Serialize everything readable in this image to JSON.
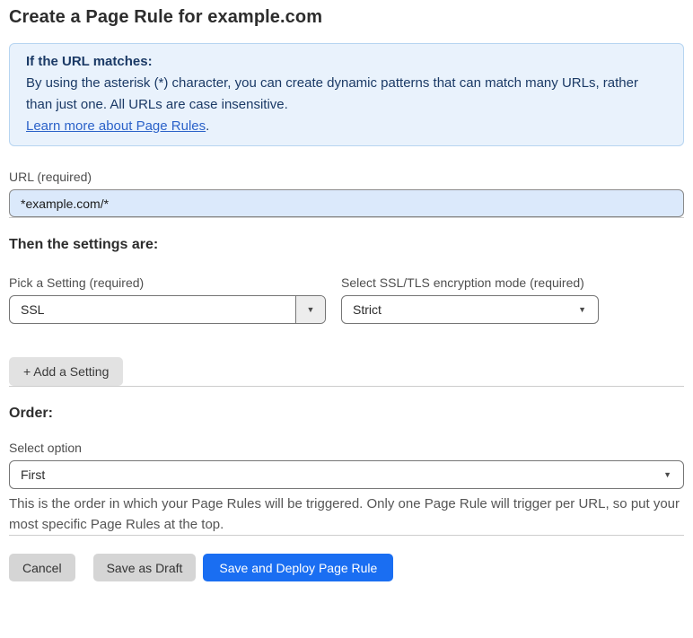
{
  "page": {
    "title": "Create a Page Rule for example.com"
  },
  "info_box": {
    "heading": "If the URL matches:",
    "body": "By using the asterisk (*) character, you can create dynamic patterns that can match many URLs, rather than just one. All URLs are case insensitive.",
    "link_label": "Learn more about Page Rules",
    "link_suffix": "."
  },
  "url_field": {
    "label": "URL (required)",
    "value": "*example.com/*"
  },
  "settings_section": {
    "heading": "Then the settings are:",
    "setting_picker": {
      "label": "Pick a Setting (required)",
      "value": "SSL"
    },
    "ssl_mode": {
      "label": "Select SSL/TLS encryption mode (required)",
      "value": "Strict"
    },
    "add_setting_label": "+ Add a Setting"
  },
  "order_section": {
    "heading": "Order:",
    "select_label": "Select option",
    "value": "First",
    "help_text": "This is the order in which your Page Rules will be triggered. Only one Page Rule will trigger per URL, so put your most specific Page Rules at the top."
  },
  "footer": {
    "cancel_label": "Cancel",
    "save_draft_label": "Save as Draft",
    "save_deploy_label": "Save and Deploy Page Rule"
  },
  "icons": {
    "dropdown_arrow": "▼"
  },
  "colors": {
    "accent_blue": "#1a6ef2",
    "info_background": "#e9f2fc",
    "info_border": "#b7d5f1",
    "info_text": "#1b3a66",
    "link_blue": "#2b62c9",
    "url_input_background": "#dbe9fb",
    "button_gray": "#d5d5d5",
    "divider_gray": "#cdcdcd"
  }
}
